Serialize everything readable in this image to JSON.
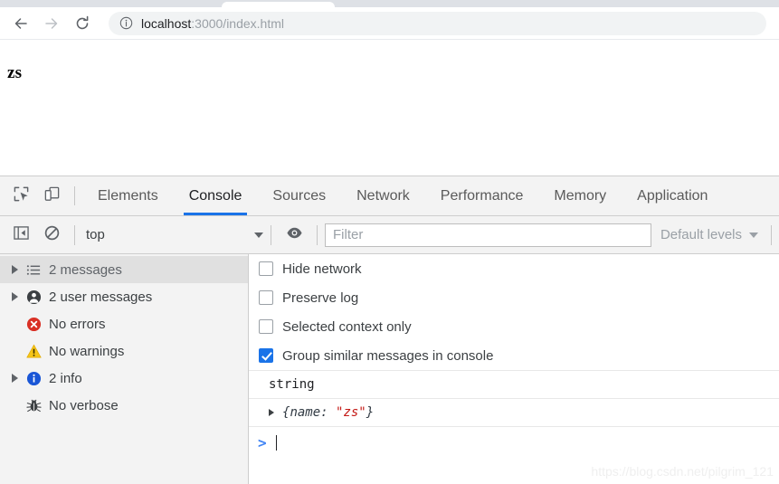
{
  "browser": {
    "back_label": "back-arrow",
    "forward_label": "forward-arrow",
    "reload_label": "reload",
    "url_host": "localhost",
    "url_path": ":3000/index.html",
    "url_full": "localhost:3000/index.html"
  },
  "page": {
    "body_text": "zs"
  },
  "devtools": {
    "tabs": [
      {
        "label": "Elements",
        "selected": false
      },
      {
        "label": "Console",
        "selected": true
      },
      {
        "label": "Sources",
        "selected": false
      },
      {
        "label": "Network",
        "selected": false
      },
      {
        "label": "Performance",
        "selected": false
      },
      {
        "label": "Memory",
        "selected": false
      },
      {
        "label": "Application",
        "selected": false
      }
    ],
    "console_toolbar": {
      "context_value": "top",
      "filter_placeholder": "Filter",
      "filter_value": "",
      "levels_value": "Default levels"
    },
    "sidebar": {
      "items": [
        {
          "label": "2 messages",
          "icon": "list-icon",
          "expandable": true,
          "selected": true
        },
        {
          "label": "2 user messages",
          "icon": "user-icon",
          "expandable": true,
          "selected": false
        },
        {
          "label": "No errors",
          "icon": "error-icon",
          "expandable": false,
          "selected": false
        },
        {
          "label": "No warnings",
          "icon": "warning-icon",
          "expandable": false,
          "selected": false
        },
        {
          "label": "2 info",
          "icon": "info-icon",
          "expandable": true,
          "selected": false
        },
        {
          "label": "No verbose",
          "icon": "bug-icon",
          "expandable": false,
          "selected": false
        }
      ]
    },
    "settings": [
      {
        "label": "Hide network",
        "checked": false
      },
      {
        "label": "Preserve log",
        "checked": false
      },
      {
        "label": "Selected context only",
        "checked": false
      },
      {
        "label": "Group similar messages in console",
        "checked": true
      }
    ],
    "log_entries": [
      {
        "type": "string",
        "text": "string",
        "expandable": false
      },
      {
        "type": "object",
        "expandable": true,
        "open_brace": "{",
        "key": "name: ",
        "value": "\"zs\"",
        "close_brace": "}"
      }
    ],
    "prompt": {
      "chevron": ">",
      "value": ""
    }
  },
  "watermark": {
    "text": "https://blog.csdn.net/pilgrim_121"
  },
  "colors": {
    "accent": "#1a73e8",
    "prompt": "#4285f4",
    "string_value": "#c41a16",
    "error": "#d93025",
    "warning": "#f5c518",
    "info": "#1a56d6"
  }
}
